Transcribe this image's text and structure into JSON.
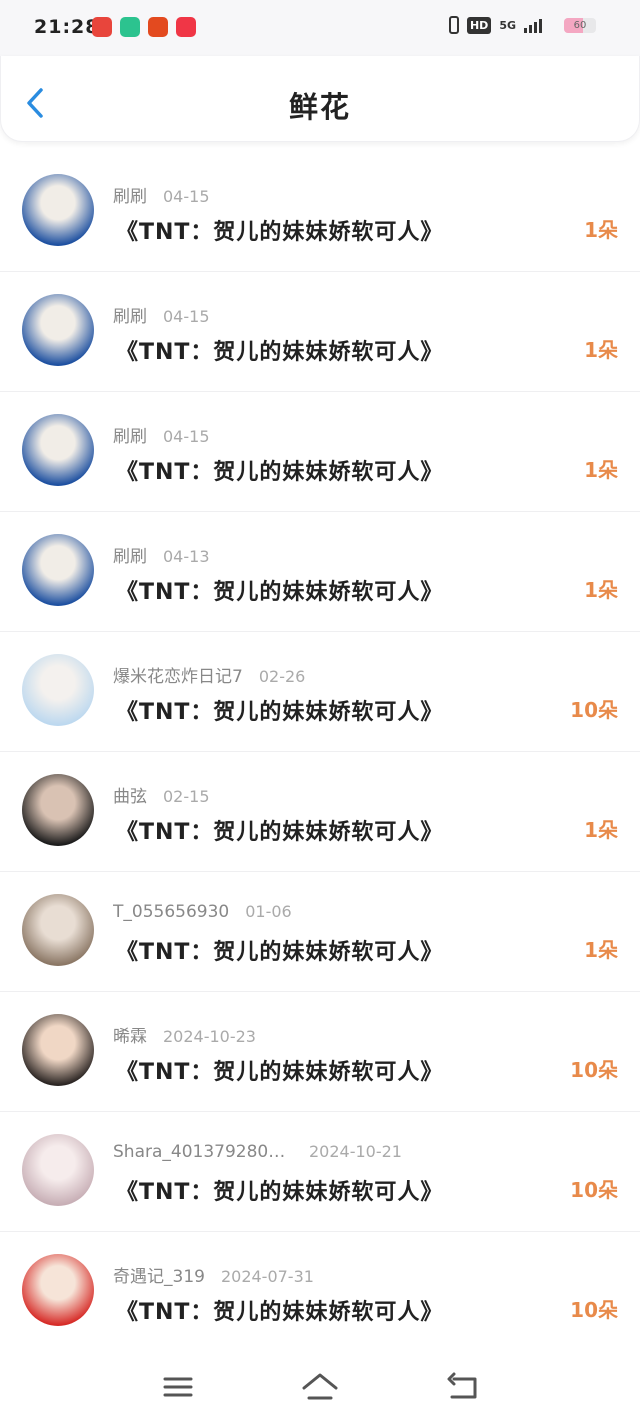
{
  "status_bar": {
    "time": "21:28",
    "network": "5G",
    "hd": "HD",
    "battery_level": "60",
    "battery_fraction": 0.6
  },
  "header": {
    "title": "鲜花",
    "back_icon": "chevron-left-icon"
  },
  "gifts": [
    {
      "user": "刷刷",
      "date": "04-15",
      "title": "《TNT：贺儿的妹妹娇软可人》",
      "amount": "1朵",
      "avatar_colors": [
        "#1c4fa0",
        "#f1ede7"
      ]
    },
    {
      "user": "刷刷",
      "date": "04-15",
      "title": "《TNT：贺儿的妹妹娇软可人》",
      "amount": "1朵",
      "avatar_colors": [
        "#1c4fa0",
        "#f1ede7"
      ]
    },
    {
      "user": "刷刷",
      "date": "04-15",
      "title": "《TNT：贺儿的妹妹娇软可人》",
      "amount": "1朵",
      "avatar_colors": [
        "#1c4fa0",
        "#f1ede7"
      ]
    },
    {
      "user": "刷刷",
      "date": "04-13",
      "title": "《TNT：贺儿的妹妹娇软可人》",
      "amount": "1朵",
      "avatar_colors": [
        "#1c4fa0",
        "#f1ede7"
      ]
    },
    {
      "user": "爆米花恋炸日记7",
      "date": "02-26",
      "title": "《TNT：贺儿的妹妹娇软可人》",
      "amount": "10朵",
      "avatar_colors": [
        "#bcd8ef",
        "#f4f1ee"
      ]
    },
    {
      "user": "曲弦",
      "date": "02-15",
      "title": "《TNT：贺儿的妹妹娇软可人》",
      "amount": "1朵",
      "avatar_colors": [
        "#1b1b1b",
        "#d9c2b3"
      ]
    },
    {
      "user": "T_055656930",
      "date": "01-06",
      "title": "《TNT：贺儿的妹妹娇软可人》",
      "amount": "1朵",
      "avatar_colors": [
        "#8a7664",
        "#e8ddd3"
      ]
    },
    {
      "user": "晞霖",
      "date": "2024-10-23",
      "title": "《TNT：贺儿的妹妹娇软可人》",
      "amount": "10朵",
      "avatar_colors": [
        "#2a2422",
        "#f0d7c5"
      ]
    },
    {
      "user": "Shara_4013792807…",
      "date": "2024-10-21",
      "title": "《TNT：贺儿的妹妹娇软可人》",
      "amount": "10朵",
      "avatar_colors": [
        "#c7aeb5",
        "#f6ecec"
      ]
    },
    {
      "user": "奇遇记_319",
      "date": "2024-07-31",
      "title": "《TNT：贺儿的妹妹娇软可人》",
      "amount": "10朵",
      "avatar_colors": [
        "#d62a26",
        "#f6e4d8"
      ]
    }
  ],
  "nav": {
    "menu_icon": "menu-icon",
    "home_icon": "home-icon",
    "back_icon": "back-icon"
  },
  "colors": {
    "accent": "#2a8ce0",
    "amount": "#e88a4a"
  }
}
